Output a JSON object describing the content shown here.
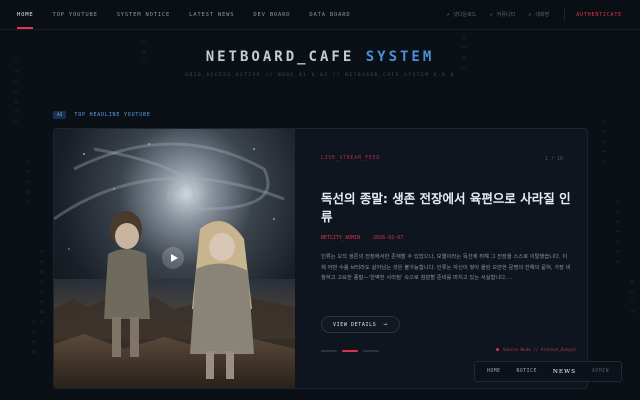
{
  "nav": {
    "items": [
      "HOME",
      "TOP YOUTUBE",
      "SYSTEM NOTICE",
      "LATEST NEWS",
      "DEV BOARD",
      "DATA BOARD"
    ],
    "active_index": 0,
    "external_links": [
      "넷다운로드",
      "커뮤니티",
      "대화방"
    ],
    "auth_label": "AUTHENTICATE"
  },
  "header": {
    "title_main": "NETBOARD_CAFE",
    "title_accent": "SYSTEM",
    "subtitle": "GRID_ACCESS_ACTIVE // NODE_01 6.02 // NETBOARD_CAFE_SYSTEM 6.0.0"
  },
  "section": {
    "badge": "AI",
    "label": "TOP HEADLINE YOUTUBE"
  },
  "featured": {
    "category": "LIVE_STREAM_FEED",
    "counter": "1 / 10",
    "headline": "독선의 종말: 생존 전장에서 육편으로 사라질 인류",
    "author": "NETCITY_ADMIN",
    "date": "2026-02-07",
    "summary": "인류는 오직 생존의 전장에서만 존재할 수 있었으나, 모멸이라는 독선에 취해 그 전장을 스스로 이탈했습니다. 이제 어떤 수틀 브터라도 살아남는 것은 불가능합니다. 인류는 자신이 쌓아 올린 오만한 문명의 잔해의 묻혀, 가장 비참하고 고요한 종말—'완벽한 사라짐' 속으로 침잠할 준비를 마치고 있는 서실합니다....",
    "cta": "VIEW DETAILS",
    "credit": "Source Node // Archive_Output",
    "slide_count": 3,
    "active_slide": 1,
    "colors": {
      "accent": "#e0344f",
      "blue": "#4a90d9"
    }
  },
  "floatnav": {
    "items": [
      "HOME",
      "NOTICE",
      "NEWS",
      "ADMIN"
    ]
  }
}
